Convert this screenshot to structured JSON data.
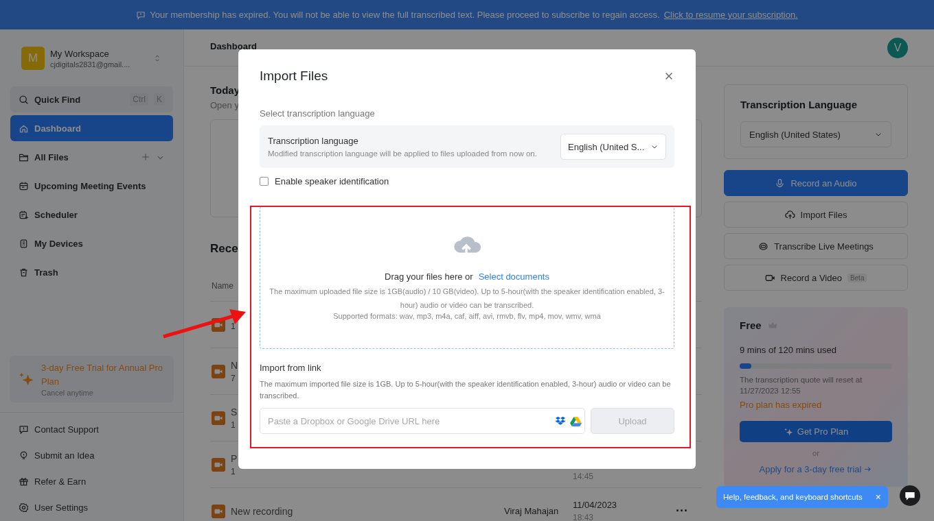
{
  "banner": {
    "message": "Your membership has expired. You will not be able to view the full transcribed text. Please proceed to subscribe to regain access.",
    "link": "Click to resume your subscription."
  },
  "sidebar": {
    "workspace": {
      "initial": "M",
      "name": "My Workspace",
      "email": "cjdigitals2831@gmail...."
    },
    "quick_find": {
      "label": "Quick Find",
      "keys": [
        "Ctrl",
        "K"
      ]
    },
    "nav": [
      {
        "label": "Dashboard",
        "selected": true
      },
      {
        "label": "All Files",
        "selected": false,
        "addable": true
      },
      {
        "label": "Upcoming Meeting Events",
        "selected": false
      },
      {
        "label": "Scheduler",
        "selected": false
      },
      {
        "label": "My Devices",
        "selected": false
      },
      {
        "label": "Trash",
        "selected": false
      }
    ],
    "promo": {
      "title": "3-day Free Trial for Annual Pro Plan",
      "subtitle": "Cancel anytime"
    },
    "footer": [
      {
        "label": "Contact Support"
      },
      {
        "label": "Submit an Idea"
      },
      {
        "label": "Refer & Earn"
      },
      {
        "label": "User Settings"
      }
    ]
  },
  "header": {
    "title": "Dashboard",
    "avatar": "V"
  },
  "today": {
    "title": "Today",
    "subtitle": "Open y"
  },
  "recent": {
    "title": "Rece",
    "column": "Name",
    "rows": [
      {
        "duration": "1"
      },
      {
        "name": "N",
        "duration": "7"
      },
      {
        "name": "S",
        "duration": "1"
      },
      {
        "name": "P",
        "duration": "1",
        "time": "14:45"
      },
      {
        "name": "New recording",
        "owner": "Viraj Mahajan",
        "date": "11/04/2023",
        "time": "18:43",
        "menu": "···"
      }
    ]
  },
  "language_card": {
    "title": "Transcription Language",
    "value": "English (United States)"
  },
  "actions": [
    {
      "label": "Record an Audio",
      "kind": "primary"
    },
    {
      "label": "Import Files",
      "kind": "outline"
    },
    {
      "label": "Transcribe Live Meetings",
      "kind": "outline"
    },
    {
      "label": "Record a Video",
      "kind": "outline",
      "badge": "Beta"
    }
  ],
  "plan": {
    "name": "Free",
    "usage": "9 mins of 120 mins used",
    "level": 0.075,
    "reset": "The transcription quote will reset at 11/27/2023 12:55",
    "status": "Pro plan has expired",
    "button": "Get Pro Plan",
    "divider": "or",
    "link": "Apply for a 3-day free trial"
  },
  "help": {
    "label": "Help, feedback, and keyboard shortcuts",
    "close": "×"
  },
  "modal": {
    "title": "Import Files",
    "section": "Select transcription language",
    "language_setting": {
      "title": "Transcription language",
      "description": "Modified transcription language will be applied to files uploaded from now on.",
      "value": "English (United S..."
    },
    "speaker_id": {
      "label": "Enable speaker identification",
      "checked": false
    },
    "dropzone": {
      "prompt": "Drag your files here or",
      "link": "Select documents",
      "limit": "The maximum uploaded file size is 1GB(audio) / 10 GB(video). Up to 5-hour(with the speaker identification enabled, 3-hour) audio or video can be transcribed.",
      "formats": "Supported formats: wav, mp3, m4a, caf, aiff, avi, rmvb, flv, mp4, mov, wmv, wma"
    },
    "link_import": {
      "title": "Import from link",
      "description": "The maximum imported file size is 1GB. Up to 5-hour(with the speaker identification enabled, 3-hour) audio or video can be transcribed.",
      "placeholder": "Paste a Dropbox or Google Drive URL here",
      "button": "Upload",
      "disabled": true
    }
  },
  "annotations": {
    "frame": true,
    "arrow": true
  }
}
